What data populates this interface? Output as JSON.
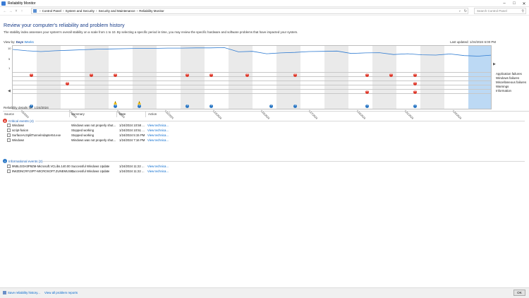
{
  "window": {
    "title": "Reliability Monitor"
  },
  "address": {
    "crumbs": [
      "Control Panel",
      "System and Security",
      "Security and Maintenance",
      "Reliability Monitor"
    ],
    "search_placeholder": "Search Control Panel"
  },
  "page": {
    "heading": "Review your computer's reliability and problem history",
    "description": "The stability index assesses your system's overall stability on a scale from 1 to 10. By selecting a specific period in time, you may review the specific hardware and software problems that have impacted your system.",
    "view_by_label": "View by:",
    "view_days": "Days",
    "view_weeks": "Weeks",
    "last_updated": "Last updated: 1/24/2024 6:00 PM"
  },
  "chart": {
    "y_labels": [
      "10",
      "5",
      "1"
    ],
    "row_labels": [
      "Application failures",
      "Windows failures",
      "Miscellaneous failures",
      "Warnings",
      "Information"
    ],
    "x_labels": [
      "1/5/2024",
      "1/7/2024",
      "1/9/2024",
      "1/11/2024",
      "1/13/2024",
      "1/15/2024",
      "1/17/2024",
      "1/19/2024",
      "1/21/2024",
      "1/23/2024"
    ],
    "stability_index": [
      9.2,
      8.7,
      8.4,
      8.7,
      8.9,
      9.1,
      9.3,
      9.4,
      9.5,
      9.6,
      9.6,
      9.7,
      9.7,
      9.8,
      9.8,
      9.9,
      8.3,
      8.5,
      7.6,
      7.9,
      8.1,
      8.4,
      8.5,
      8.6,
      7.7,
      7.9,
      8.0,
      7.3,
      7.6,
      7.2,
      7.1,
      7.5,
      6.9,
      6.7,
      7.1
    ],
    "app_failures_cols": [
      1,
      6,
      8,
      14,
      16,
      19,
      23,
      29,
      31,
      33
    ],
    "windows_failures_cols": [
      4,
      33
    ],
    "misc_failures_cols": [
      29,
      33
    ],
    "warnings_cols": [
      8,
      10
    ],
    "information_cols": [
      1,
      8,
      10,
      14,
      16,
      21,
      23,
      29,
      33
    ],
    "selected_col": 33
  },
  "details": {
    "title": "Reliability details for: 1/24/2024",
    "columns": {
      "source": "Source",
      "summary": "Summary",
      "date": "Date",
      "action": "Action"
    },
    "critical_label": "Critical events (4)",
    "critical": [
      {
        "source": "Windows",
        "summary": "Windows was not properly shut...",
        "date": "1/24/2024 10:58 ...",
        "action": "View technica..."
      },
      {
        "source": "script-fusion",
        "summary": "Stopped working",
        "date": "1/24/2024 10:51 ...",
        "action": "View technica..."
      },
      {
        "source": "SurfaceAcSplitTunnelAdapter64.exe",
        "summary": "Stopped working",
        "date": "1/24/2024 5:15 PM",
        "action": "View technica..."
      },
      {
        "source": "Windows",
        "summary": "Windows was not properly shut...",
        "date": "1/24/2024 7:16 PM",
        "action": "View technica..."
      }
    ],
    "info_label": "Informational events (2)",
    "informational": [
      {
        "source": "9NBLGGH3P9ZM-Microsoft.VCLibs.140.00",
        "summary": "Successful Windows Update",
        "date": "1/24/2024 11:22 ...",
        "action": "View technica..."
      },
      {
        "source": "9WZDNCRFJ3PT-MICROSOFT.ZUNEMUSIC",
        "summary": "Successful Windows Update",
        "date": "1/24/2024 11:22 ...",
        "action": "View technica..."
      }
    ]
  },
  "footer": {
    "save": "Save reliability history...",
    "view_all": "View all problem reports",
    "ok": "OK"
  }
}
